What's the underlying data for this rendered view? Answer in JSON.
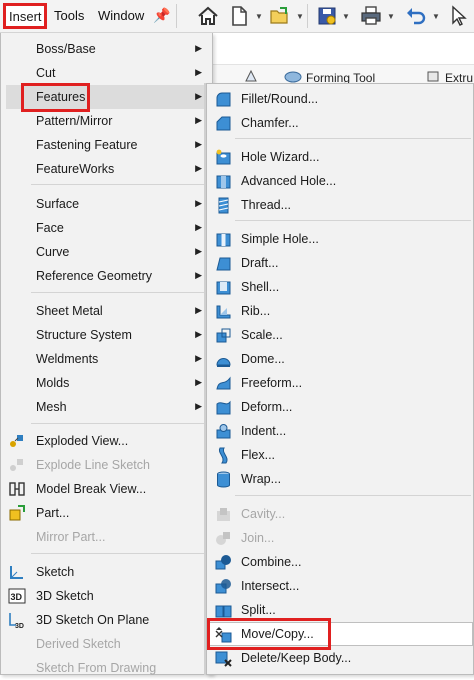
{
  "menubar": {
    "items": [
      "Insert",
      "Tools",
      "Window"
    ],
    "icons": [
      "pin-icon",
      "home-icon",
      "new-document-icon",
      "open-folder-icon",
      "save-icon",
      "print-icon",
      "undo-icon",
      "select-arrow-icon"
    ]
  },
  "background": {
    "tabs": [
      "Forming Tool",
      "Extru"
    ]
  },
  "insert_menu": {
    "items": [
      {
        "label": "Boss/Base",
        "submenu": true
      },
      {
        "label": "Cut",
        "submenu": true
      },
      {
        "label": "Features",
        "submenu": true,
        "active": true
      },
      {
        "label": "Pattern/Mirror",
        "submenu": true
      },
      {
        "label": "Fastening Feature",
        "submenu": true
      },
      {
        "label": "FeatureWorks",
        "submenu": true
      },
      {
        "label": "Surface",
        "submenu": true
      },
      {
        "label": "Face",
        "submenu": true
      },
      {
        "label": "Curve",
        "submenu": true
      },
      {
        "label": "Reference Geometry",
        "submenu": true
      },
      {
        "label": "Sheet Metal",
        "submenu": true
      },
      {
        "label": "Structure System",
        "submenu": true
      },
      {
        "label": "Weldments",
        "submenu": true
      },
      {
        "label": "Molds",
        "submenu": true
      },
      {
        "label": "Mesh",
        "submenu": true
      },
      {
        "label": "Exploded View...",
        "icon": "exploded-view-icon"
      },
      {
        "label": "Explode Line Sketch",
        "icon": "explode-line-sketch-icon",
        "disabled": true
      },
      {
        "label": "Model Break View...",
        "icon": "model-break-view-icon"
      },
      {
        "label": "Part...",
        "icon": "part-icon"
      },
      {
        "label": "Mirror Part...",
        "disabled": true
      },
      {
        "label": "Sketch",
        "icon": "sketch-icon"
      },
      {
        "label": "3D Sketch",
        "icon": "3d-sketch-icon"
      },
      {
        "label": "3D Sketch On Plane",
        "icon": "3d-sketch-on-plane-icon"
      },
      {
        "label": "Derived Sketch",
        "disabled": true
      },
      {
        "label": "Sketch From Drawing",
        "disabled": true
      }
    ]
  },
  "features_menu": {
    "items": [
      {
        "label": "Fillet/Round...",
        "icon": "fillet-icon"
      },
      {
        "label": "Chamfer...",
        "icon": "chamfer-icon"
      },
      {
        "label": "Hole Wizard...",
        "icon": "hole-wizard-icon"
      },
      {
        "label": "Advanced Hole...",
        "icon": "advanced-hole-icon"
      },
      {
        "label": "Thread...",
        "icon": "thread-icon"
      },
      {
        "label": "Simple Hole...",
        "icon": "simple-hole-icon"
      },
      {
        "label": "Draft...",
        "icon": "draft-icon"
      },
      {
        "label": "Shell...",
        "icon": "shell-icon"
      },
      {
        "label": "Rib...",
        "icon": "rib-icon"
      },
      {
        "label": "Scale...",
        "icon": "scale-icon"
      },
      {
        "label": "Dome...",
        "icon": "dome-icon"
      },
      {
        "label": "Freeform...",
        "icon": "freeform-icon"
      },
      {
        "label": "Deform...",
        "icon": "deform-icon"
      },
      {
        "label": "Indent...",
        "icon": "indent-icon"
      },
      {
        "label": "Flex...",
        "icon": "flex-icon"
      },
      {
        "label": "Wrap...",
        "icon": "wrap-icon"
      },
      {
        "label": "Cavity...",
        "icon": "cavity-icon",
        "disabled": true
      },
      {
        "label": "Join...",
        "icon": "join-icon",
        "disabled": true
      },
      {
        "label": "Combine...",
        "icon": "combine-icon"
      },
      {
        "label": "Intersect...",
        "icon": "intersect-icon"
      },
      {
        "label": "Split...",
        "icon": "split-icon"
      },
      {
        "label": "Move/Copy...",
        "icon": "move-copy-icon",
        "active": true
      },
      {
        "label": "Delete/Keep Body...",
        "icon": "delete-keep-body-icon"
      }
    ]
  },
  "colors": {
    "highlight_box": "#e02020",
    "menu_bg": "#f2f2f2",
    "icon_blue": "#2f7fc1",
    "disabled_text": "#a6a6a6"
  }
}
